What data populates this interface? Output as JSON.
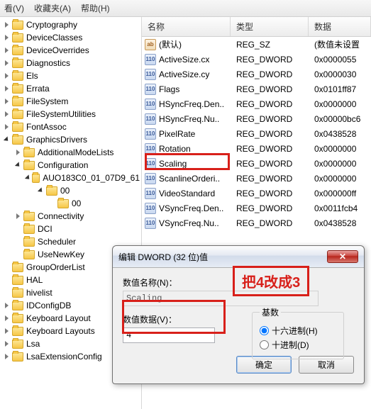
{
  "menu": {
    "view": "看(V)",
    "favorites": "收藏夹(A)",
    "help": "帮助(H)"
  },
  "tree": [
    {
      "level": 1,
      "label": "Cryptography",
      "expander": "has"
    },
    {
      "level": 1,
      "label": "DeviceClasses",
      "expander": "has"
    },
    {
      "level": 1,
      "label": "DeviceOverrides",
      "expander": "has"
    },
    {
      "level": 1,
      "label": "Diagnostics",
      "expander": "has"
    },
    {
      "level": 1,
      "label": "Els",
      "expander": "has"
    },
    {
      "level": 1,
      "label": "Errata",
      "expander": "has"
    },
    {
      "level": 1,
      "label": "FileSystem",
      "expander": "has"
    },
    {
      "level": 1,
      "label": "FileSystemUtilities",
      "expander": "has"
    },
    {
      "level": 1,
      "label": "FontAssoc",
      "expander": "has"
    },
    {
      "level": 1,
      "label": "GraphicsDrivers",
      "expander": "open"
    },
    {
      "level": 2,
      "label": "AdditionalModeLists",
      "expander": "has"
    },
    {
      "level": 2,
      "label": "Configuration",
      "expander": "open"
    },
    {
      "level": 3,
      "label": "AUO183C0_01_07D9_61",
      "expander": "open"
    },
    {
      "level": 4,
      "label": "00",
      "expander": "open"
    },
    {
      "level": 5,
      "label": "00",
      "expander": "none"
    },
    {
      "level": 2,
      "label": "Connectivity",
      "expander": "has"
    },
    {
      "level": 2,
      "label": "DCI",
      "expander": "none"
    },
    {
      "level": 2,
      "label": "Scheduler",
      "expander": "none"
    },
    {
      "level": 2,
      "label": "UseNewKey",
      "expander": "none"
    },
    {
      "level": 1,
      "label": "GroupOrderList",
      "expander": "none"
    },
    {
      "level": 1,
      "label": "HAL",
      "expander": "none"
    },
    {
      "level": 1,
      "label": "hivelist",
      "expander": "none"
    },
    {
      "level": 1,
      "label": "IDConfigDB",
      "expander": "has"
    },
    {
      "level": 1,
      "label": "Keyboard Layout",
      "expander": "has"
    },
    {
      "level": 1,
      "label": "Keyboard Layouts",
      "expander": "has"
    },
    {
      "level": 1,
      "label": "Lsa",
      "expander": "has"
    },
    {
      "level": 1,
      "label": "LsaExtensionConfig",
      "expander": "has"
    }
  ],
  "columns": {
    "name": "名称",
    "type": "类型",
    "data": "数据"
  },
  "values": [
    {
      "icon": "str",
      "name": "(默认)",
      "type": "REG_SZ",
      "data": "(数值未设置"
    },
    {
      "icon": "bin",
      "name": "ActiveSize.cx",
      "type": "REG_DWORD",
      "data": "0x0000055"
    },
    {
      "icon": "bin",
      "name": "ActiveSize.cy",
      "type": "REG_DWORD",
      "data": "0x0000030"
    },
    {
      "icon": "bin",
      "name": "Flags",
      "type": "REG_DWORD",
      "data": "0x0101ff87"
    },
    {
      "icon": "bin",
      "name": "HSyncFreq.Den..",
      "type": "REG_DWORD",
      "data": "0x0000000"
    },
    {
      "icon": "bin",
      "name": "HSyncFreq.Nu..",
      "type": "REG_DWORD",
      "data": "0x00000bc6"
    },
    {
      "icon": "bin",
      "name": "PixelRate",
      "type": "REG_DWORD",
      "data": "0x0438528"
    },
    {
      "icon": "bin",
      "name": "Rotation",
      "type": "REG_DWORD",
      "data": "0x0000000"
    },
    {
      "icon": "bin",
      "name": "Scaling",
      "type": "REG_DWORD",
      "data": "0x0000000"
    },
    {
      "icon": "bin",
      "name": "ScanlineOrderi..",
      "type": "REG_DWORD",
      "data": "0x0000000"
    },
    {
      "icon": "bin",
      "name": "VideoStandard",
      "type": "REG_DWORD",
      "data": "0x000000ff"
    },
    {
      "icon": "bin",
      "name": "VSyncFreq.Den..",
      "type": "REG_DWORD",
      "data": "0x0011fcb4"
    },
    {
      "icon": "bin",
      "name": "VSyncFreq.Nu..",
      "type": "REG_DWORD",
      "data": "0x0438528"
    }
  ],
  "dialog": {
    "title": "编辑 DWORD (32 位)值",
    "name_label": "数值名称(N)：",
    "name_value": "Scaling",
    "data_label": "数值数据(V)：",
    "data_value": "4",
    "radix_label": "基数",
    "hex": "十六进制(H)",
    "dec": "十进制(D)",
    "ok": "确定",
    "cancel": "取消"
  },
  "annotation": "把4改成3"
}
